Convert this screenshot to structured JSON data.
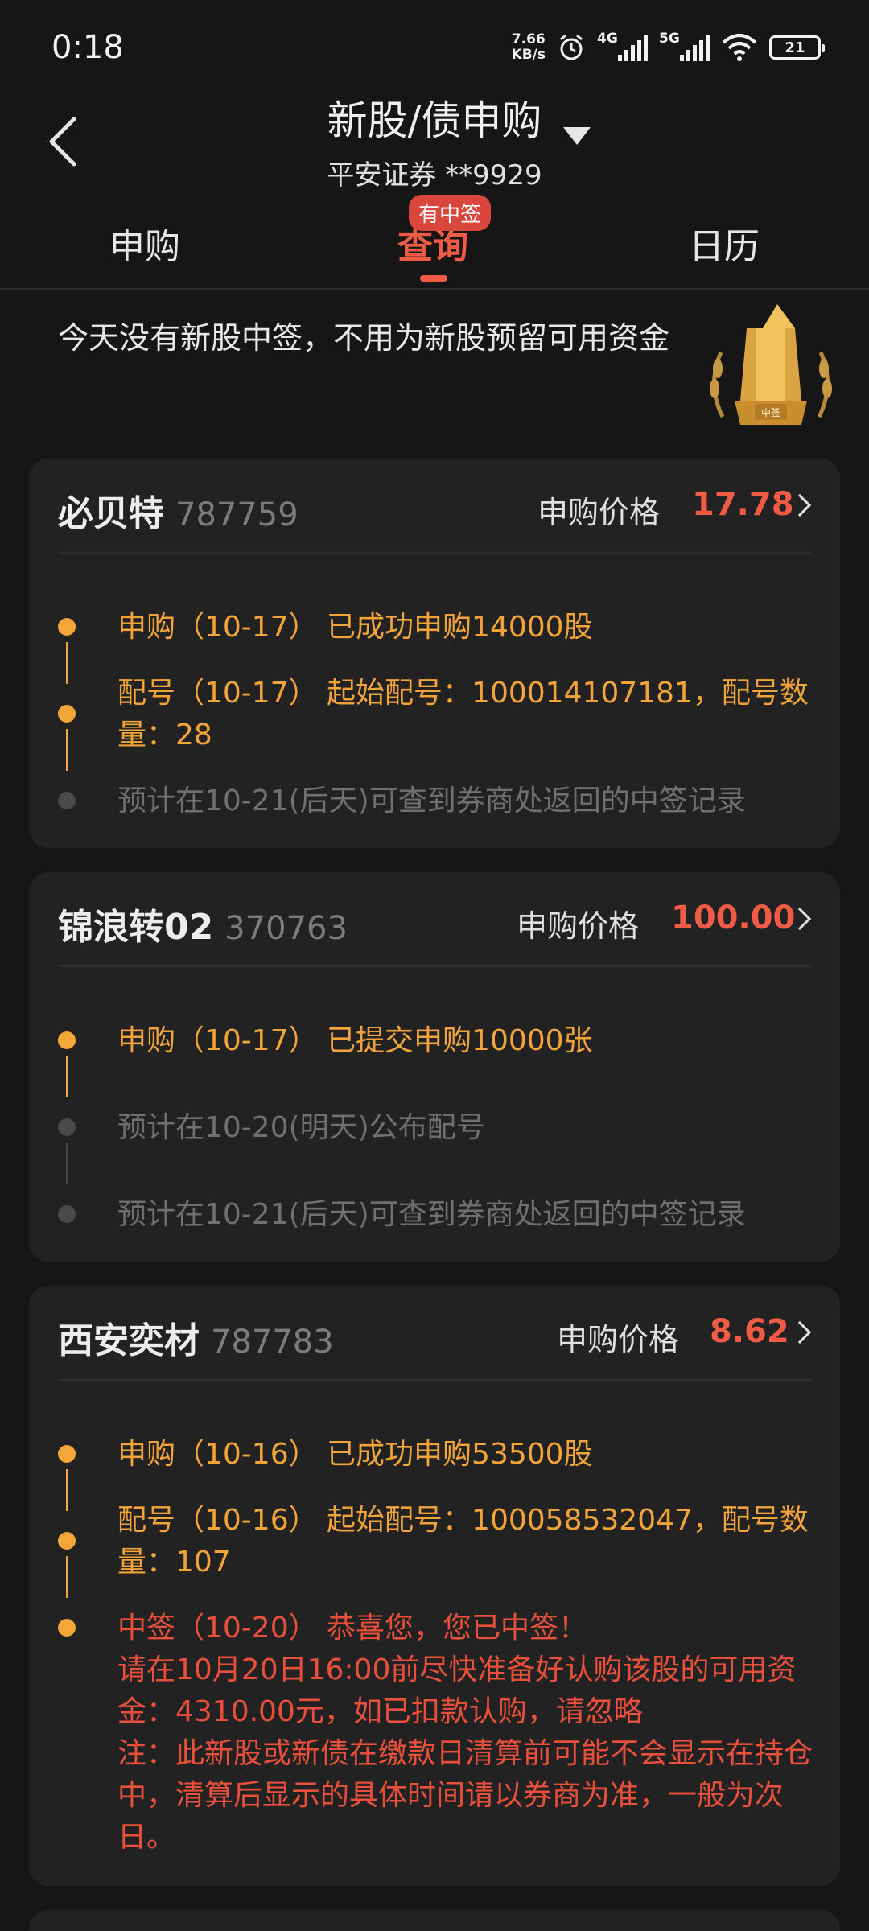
{
  "status_bar": {
    "time": "0:18",
    "net_speed_value": "7.66",
    "net_speed_unit": "KB/s",
    "sim1_tag": "4G",
    "sim2_tag": "5G",
    "battery": "21",
    "icons": [
      "alarm-icon",
      "signal-icon",
      "wifi-icon",
      "battery-icon"
    ]
  },
  "header": {
    "title": "新股/债申购",
    "subtitle": "平安证券 **9929"
  },
  "tabs": [
    {
      "label": "申购",
      "active": false
    },
    {
      "label": "查询",
      "active": true,
      "badge": "有中签"
    },
    {
      "label": "日历",
      "active": false
    }
  ],
  "notice": "今天没有新股中签，不用为新股预留可用资金",
  "trophy_label": "中签",
  "cards": [
    {
      "name": "必贝特",
      "code": "787759",
      "price_label": "申购价格",
      "price": "17.78",
      "events": [
        {
          "text": "申购（10-17） 已成功申购14000股",
          "state": "done"
        },
        {
          "text": "配号（10-17） 起始配号：100014107181，配号数量：28",
          "state": "done"
        },
        {
          "text": "预计在10-21(后天)可查到券商处返回的中签记录",
          "state": "pending"
        }
      ]
    },
    {
      "name": "锦浪转02",
      "code": "370763",
      "price_label": "申购价格",
      "price": "100.00",
      "events": [
        {
          "text": "申购（10-17） 已提交申购10000张",
          "state": "done"
        },
        {
          "text": "预计在10-20(明天)公布配号",
          "state": "pending"
        },
        {
          "text": "预计在10-21(后天)可查到券商处返回的中签记录",
          "state": "pending"
        }
      ]
    },
    {
      "name": "西安奕材",
      "code": "787783",
      "price_label": "申购价格",
      "price": "8.62",
      "events": [
        {
          "text": "申购（10-16） 已成功申购53500股",
          "state": "done"
        },
        {
          "text": "配号（10-16） 起始配号：100058532047，配号数量：107",
          "state": "done"
        },
        {
          "text": "中签（10-20） 恭喜您，您已中签！",
          "state": "won"
        }
      ],
      "won_detail_1": "请在10月20日16:00前尽快准备好认购该股的可用资金：4310.00元，如已扣款认购，请忽略",
      "won_detail_2": "注：此新股或新债在缴款日清算前可能不会显示在持仓中，清算后显示的具体时间请以券商为准，一般为次日。"
    }
  ],
  "colors": {
    "background": "#161616",
    "card": "#222222",
    "accent_red": "#ef5b45",
    "timeline_orange": "#f5a638",
    "muted": "#707070"
  }
}
